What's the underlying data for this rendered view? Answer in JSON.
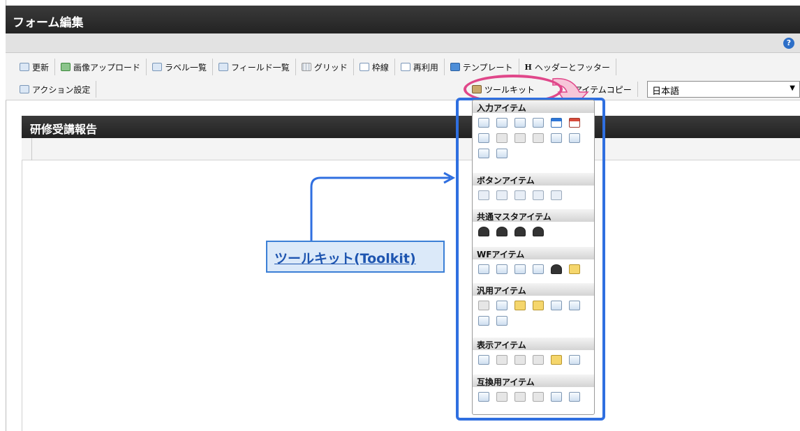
{
  "window": {
    "title": "フォーム編集"
  },
  "toolbar": {
    "row1": [
      "更新",
      "画像アップロード",
      "ラベル一覧",
      "フィールド一覧",
      "グリッド",
      "枠線",
      "再利用",
      "テンプレート",
      "ヘッダーとフッター"
    ],
    "row2": [
      "アクション設定"
    ],
    "toolkit_label": "ツールキット",
    "itemcopy_label": "アイテムコピー",
    "language_value": "日本語"
  },
  "form": {
    "title": "研修受講報告"
  },
  "callout": {
    "text": "ツールキット(Toolkit)"
  },
  "toolkit": {
    "sections": [
      {
        "title": "入力アイテム",
        "icons": [
          "text-field-icon",
          "textarea-icon",
          "number-icon",
          "formula-icon",
          "date-icon",
          "datetime-icon",
          "pulldown-icon",
          "listbox-icon",
          "checkbox-icon",
          "radio-icon",
          "selector-icon",
          "table-icon",
          "upload-icon",
          "list-icon"
        ]
      },
      {
        "title": "ボタンアイテム",
        "icons": [
          "btn-event-icon",
          "btn-next-icon",
          "btn-prev-icon",
          "btn-back-icon",
          "btn-forward-icon"
        ]
      },
      {
        "title": "共通マスタアイテム",
        "icons": [
          "user-icon",
          "org-icon",
          "role-icon",
          "company-icon"
        ]
      },
      {
        "title": "WFアイテム",
        "icons": [
          "approval-icon",
          "attachment-icon",
          "comment-icon",
          "history-icon",
          "proxy-icon",
          "stamp-icon"
        ]
      },
      {
        "title": "汎用アイテム",
        "icons": [
          "dotted-line-icon",
          "document-icon",
          "image-icon",
          "link-icon",
          "tag-icon",
          "download-icon",
          "frame-icon",
          "media-icon"
        ]
      },
      {
        "title": "表示アイテム",
        "icons": [
          "label-icon",
          "hline-icon",
          "vline-icon",
          "box-icon",
          "picture-icon",
          "text-icon"
        ]
      },
      {
        "title": "互換用アイテム",
        "icons": [
          "pulldown-icon",
          "listbox-icon",
          "checkbox-icon",
          "radio-icon",
          "selector-icon",
          "table-icon"
        ]
      }
    ]
  }
}
